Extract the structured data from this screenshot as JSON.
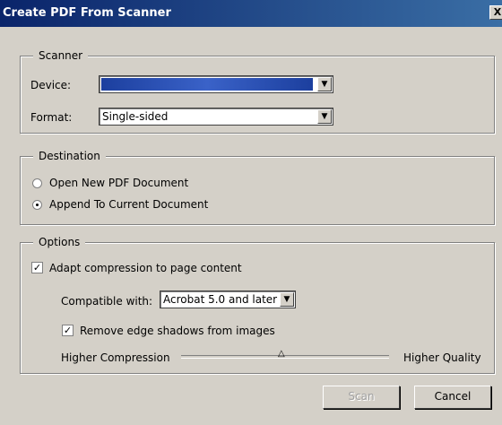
{
  "window": {
    "title": "Create PDF From Scanner",
    "close_glyph": "X"
  },
  "scanner": {
    "legend": "Scanner",
    "device_label": "Device:",
    "device_value": "",
    "format_label": "Format:",
    "format_value": "Single-sided"
  },
  "destination": {
    "legend": "Destination",
    "options": [
      {
        "label": "Open New PDF Document",
        "selected": false
      },
      {
        "label": "Append To Current Document",
        "selected": true
      }
    ]
  },
  "options": {
    "legend": "Options",
    "adapt_label": "Adapt compression to page content",
    "adapt_checked": true,
    "compatible_label": "Compatible with:",
    "compatible_value": "Acrobat 5.0 and later",
    "remove_shadows_label": "Remove edge shadows from images",
    "remove_shadows_checked": true,
    "slider_left_label": "Higher Compression",
    "slider_right_label": "Higher Quality",
    "slider_level": 0.5
  },
  "buttons": {
    "scan": "Scan",
    "cancel": "Cancel"
  }
}
